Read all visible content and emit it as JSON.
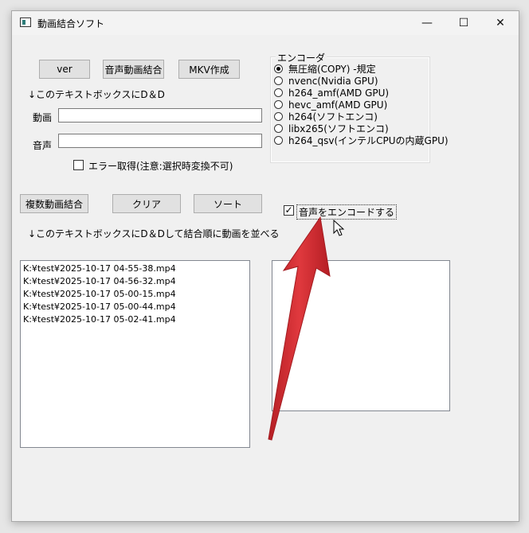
{
  "window": {
    "title": "動画結合ソフト"
  },
  "titlebar": {
    "minimize": "—",
    "maximize": "☐",
    "close": "✕"
  },
  "top_buttons": {
    "ver": "ver",
    "audio_video_merge": "音声動画結合",
    "mkv_create": "MKV作成"
  },
  "hint1": "↓このテキストボックスにD＆D",
  "fields": {
    "video_label": "動画",
    "video_value": "",
    "audio_label": "音声",
    "audio_value": ""
  },
  "error_checkbox": {
    "label": "エラー取得(注意:選択時変換不可)",
    "checked": false
  },
  "encoder": {
    "title": "エンコーダ",
    "options": [
      {
        "label": "無圧縮(COPY) -規定",
        "selected": true
      },
      {
        "label": "nvenc(Nvidia GPU)",
        "selected": false
      },
      {
        "label": "h264_amf(AMD GPU)",
        "selected": false
      },
      {
        "label": "hevc_amf(AMD GPU)",
        "selected": false
      },
      {
        "label": "h264(ソフトエンコ)",
        "selected": false
      },
      {
        "label": "libx265(ソフトエンコ)",
        "selected": false
      },
      {
        "label": "h264_qsv(インテルCPUの内蔵GPU)",
        "selected": false
      }
    ]
  },
  "mid_buttons": {
    "multi_merge": "複数動画結合",
    "clear": "クリア",
    "sort": "ソート"
  },
  "encode_audio": {
    "label": "音声をエンコードする",
    "checked": true
  },
  "hint2": "↓このテキストボックスにD＆Dして結合順に動画を並べる",
  "file_list": [
    "K:¥test¥2025-10-17 04-55-38.mp4",
    "K:¥test¥2025-10-17 04-56-32.mp4",
    "K:¥test¥2025-10-17 05-00-15.mp4",
    "K:¥test¥2025-10-17 05-00-44.mp4",
    "K:¥test¥2025-10-17 05-02-41.mp4"
  ],
  "colors": {
    "arrow": "#d8262c",
    "selected_dot": "#000000"
  }
}
